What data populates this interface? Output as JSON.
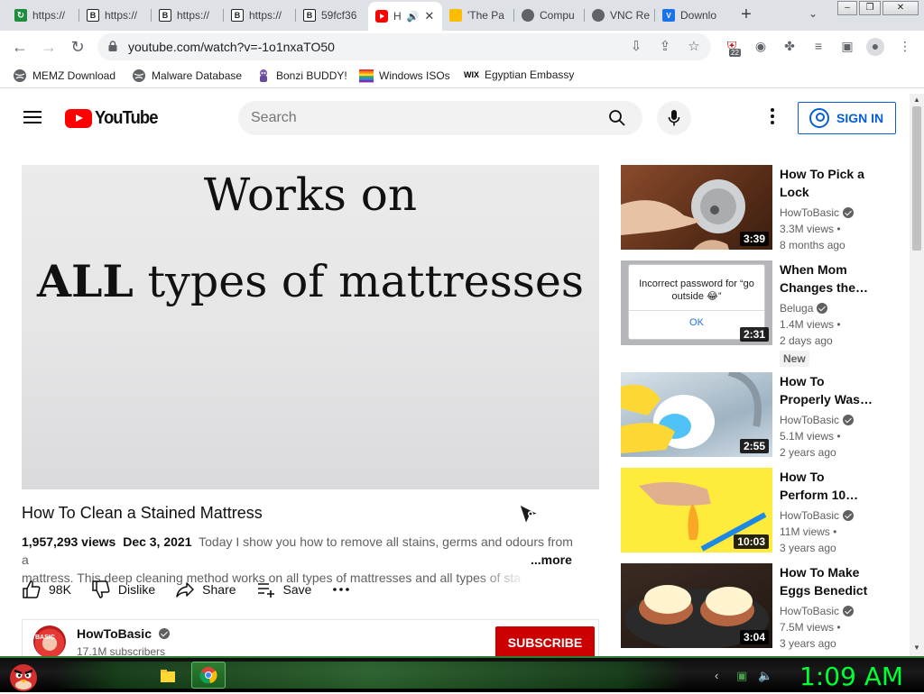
{
  "browser": {
    "tabs": [
      {
        "label": "https://",
        "icon": "green-app-icon"
      },
      {
        "label": "https://",
        "icon": "b-icon"
      },
      {
        "label": "https://",
        "icon": "b-icon"
      },
      {
        "label": "https://",
        "icon": "b-icon"
      },
      {
        "label": "59fcf36",
        "icon": "b-icon"
      },
      {
        "label": "H",
        "icon": "youtube-icon",
        "active": true
      },
      {
        "label": "'The Pa",
        "icon": "yellow-site-icon"
      },
      {
        "label": "Compu",
        "icon": "gear-site-icon"
      },
      {
        "label": "VNC Re",
        "icon": "gear-site-icon"
      },
      {
        "label": "Downlo",
        "icon": "vscode-icon"
      }
    ],
    "url": "youtube.com/watch?v=-1o1nxaTO50",
    "extension_badge": "22",
    "bookmarks": [
      {
        "label": "MEMZ Download",
        "icon": "globe-icon"
      },
      {
        "label": "Malware Database",
        "icon": "globe-icon"
      },
      {
        "label": "Bonzi BUDDY!",
        "icon": "bonzi-icon"
      },
      {
        "label": "Windows ISOs",
        "icon": "rainbow-flag-icon"
      },
      {
        "label": "Egyptian Embassy",
        "icon": "wix-icon"
      }
    ],
    "wix_text": "WIX"
  },
  "youtube": {
    "logo_text": "YouTube",
    "search_placeholder": "Search",
    "signin_label": "SIGN IN",
    "player": {
      "line1": "Works on",
      "line2_bold": "ALL",
      "line2_rest": " types of mattresses"
    },
    "video": {
      "title": "How To Clean a Stained Mattress",
      "views": "1,957,293 views",
      "date": "Dec 3, 2021",
      "description_line1": "Today I show you how to remove all stains, germs and odours from a",
      "description_line2": "mattress. This deep cleaning method works on all types of mattresses and all types of sta",
      "more_label": "...more",
      "likes": "98K",
      "dislike_label": "Dislike",
      "share_label": "Share",
      "save_label": "Save"
    },
    "channel": {
      "name": "HowToBasic",
      "subscribers": "17.1M subscribers",
      "subscribe_label": "SUBSCRIBE"
    },
    "recommendations": [
      {
        "title": "How To Pick a Lock",
        "channel": "HowToBasic",
        "views": "3.3M views",
        "age": "8 months ago",
        "duration": "3:39",
        "new": false
      },
      {
        "title": "When Mom Changes the…",
        "channel": "Beluga",
        "views": "1.4M views",
        "age": "2 days ago",
        "duration": "2:31",
        "new": true,
        "new_label": "New",
        "thumb_text": "Incorrect password for “go outside 😂”",
        "thumb_button": "OK"
      },
      {
        "title": "How To Properly Was…",
        "channel": "HowToBasic",
        "views": "5.1M views",
        "age": "2 years ago",
        "duration": "2:55",
        "new": false
      },
      {
        "title": "How To Perform 10…",
        "channel": "HowToBasic",
        "views": "11M views",
        "age": "3 years ago",
        "duration": "10:03",
        "new": false
      },
      {
        "title": "How To Make Eggs Benedict",
        "channel": "HowToBasic",
        "views": "7.5M views",
        "age": "3 years ago",
        "duration": "3:04",
        "new": false
      }
    ]
  },
  "taskbar": {
    "clock": "1:09 AM"
  },
  "colors": {
    "youtube_red": "#ff0000",
    "subscribe_red": "#cc0000",
    "link_blue": "#065fd4",
    "clock_green": "#00ff33"
  }
}
